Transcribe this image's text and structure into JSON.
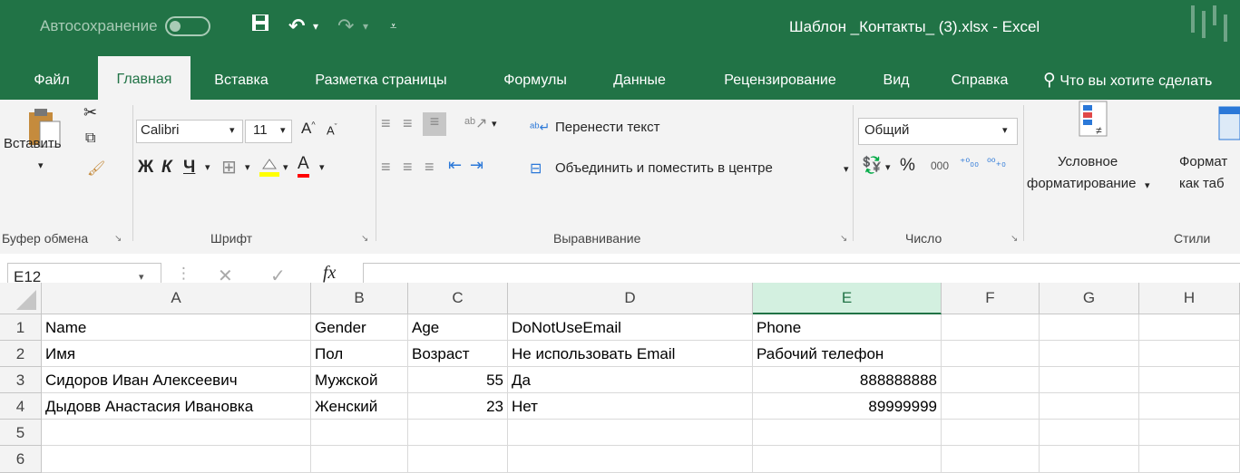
{
  "titlebar": {
    "autosave_label": "Автосохранение",
    "autosave_state": "off",
    "doc_title": "Шаблон _Контакты_ (3).xlsx  -  Excel",
    "accent": "#217346"
  },
  "tabs": [
    "Файл",
    "Главная",
    "Вставка",
    "Разметка страницы",
    "Формулы",
    "Данные",
    "Рецензирование",
    "Вид",
    "Справка"
  ],
  "active_tab": "Главная",
  "tell_me": "Что вы хотите сделать",
  "ribbon": {
    "clipboard": {
      "paste": "Вставить",
      "label": "Буфер обмена"
    },
    "font": {
      "name": "Calibri",
      "size": "11",
      "bold": "Ж",
      "italic": "К",
      "underline": "Ч",
      "label": "Шрифт"
    },
    "alignment": {
      "wrap": "Перенести текст",
      "merge": "Объединить и поместить в центре",
      "label": "Выравнивание"
    },
    "number": {
      "format": "Общий",
      "percent": "%",
      "thousands": "000",
      "label": "Число"
    },
    "styles": {
      "conditional_line1": "Условное",
      "conditional_line2": "форматирование",
      "format_table_line1": "Формат",
      "format_table_line2": "как таб",
      "label": "Стили"
    }
  },
  "formula_bar": {
    "name_box": "E12",
    "fx": "fx",
    "formula": ""
  },
  "columns": [
    "A",
    "B",
    "C",
    "D",
    "E",
    "F",
    "G",
    "H"
  ],
  "selected_column": "E",
  "rows": [
    {
      "num": "1",
      "cells": [
        "Name",
        "Gender",
        "Age",
        "DoNotUseEmail",
        "Phone",
        "",
        "",
        ""
      ]
    },
    {
      "num": "2",
      "cells": [
        "Имя",
        "Пол",
        "Возраст",
        "Не использовать Email",
        "Рабочий телефон",
        "",
        "",
        ""
      ]
    },
    {
      "num": "3",
      "cells": [
        "Сидоров Иван Алексеевич",
        "Мужской",
        "55",
        "Да",
        "888888888",
        "",
        "",
        ""
      ]
    },
    {
      "num": "4",
      "cells": [
        "Дыдовв Анастасия Ивановка",
        "Женский",
        "23",
        "Нет",
        "89999999",
        "",
        "",
        ""
      ]
    },
    {
      "num": "5",
      "cells": [
        "",
        "",
        "",
        "",
        "",
        "",
        "",
        ""
      ]
    },
    {
      "num": "6",
      "cells": [
        "",
        "",
        "",
        "",
        "",
        "",
        "",
        ""
      ]
    }
  ]
}
